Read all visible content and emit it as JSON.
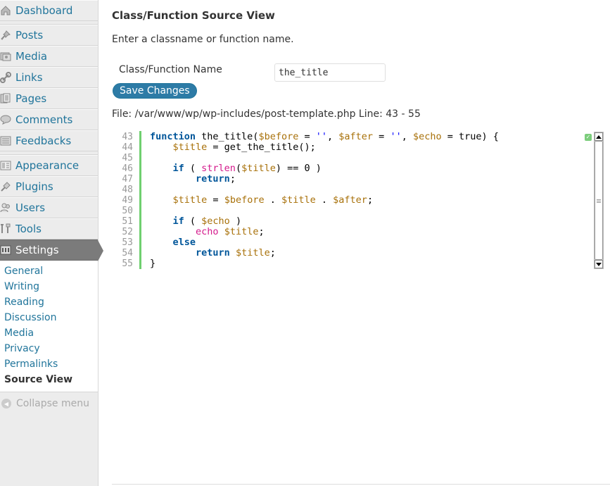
{
  "sidebar": {
    "menu": [
      {
        "key": "dashboard",
        "label": "Dashboard",
        "icon": "dashboard-icon"
      },
      {
        "key": "posts",
        "label": "Posts",
        "icon": "pushpin-icon"
      },
      {
        "key": "media",
        "label": "Media",
        "icon": "media-icon"
      },
      {
        "key": "links",
        "label": "Links",
        "icon": "link-icon"
      },
      {
        "key": "pages",
        "label": "Pages",
        "icon": "pages-icon"
      },
      {
        "key": "comments",
        "label": "Comments",
        "icon": "comment-bubble-icon"
      },
      {
        "key": "feedbacks",
        "label": "Feedbacks",
        "icon": "feedback-icon"
      },
      {
        "key": "appearance",
        "label": "Appearance",
        "icon": "appearance-icon"
      },
      {
        "key": "plugins",
        "label": "Plugins",
        "icon": "plug-icon"
      },
      {
        "key": "users",
        "label": "Users",
        "icon": "users-icon"
      },
      {
        "key": "tools",
        "label": "Tools",
        "icon": "tools-icon"
      },
      {
        "key": "settings",
        "label": "Settings",
        "icon": "settings-icon"
      }
    ],
    "submenu": [
      "General",
      "Writing",
      "Reading",
      "Discussion",
      "Media",
      "Privacy",
      "Permalinks",
      "Source View"
    ],
    "current_submenu": "Source View",
    "collapse_label": "Collapse menu"
  },
  "main": {
    "title": "Class/Function Source View",
    "intro": "Enter a classname or function name.",
    "field_label": "Class/Function Name",
    "field_value": "the_title",
    "save_label": "Save Changes",
    "file_info": "File: /var/www/wp/wp-includes/post-template.php Line: 43 - 55"
  },
  "code": {
    "line_numbers": [
      "43",
      "44",
      "45",
      "46",
      "47",
      "48",
      "49",
      "50",
      "51",
      "52",
      "53",
      "54",
      "55"
    ],
    "lines": [
      "function the_title($before = '', $after = '', $echo = true) {",
      "    $title = get_the_title();",
      "",
      "    if ( strlen($title) == 0 )",
      "        return;",
      "",
      "    $title = $before . $title . $after;",
      "",
      "    if ( $echo )",
      "        echo $title;",
      "    else",
      "        return $title;",
      "}"
    ]
  },
  "colors": {
    "link": "#21759b",
    "keyword": "#00569a",
    "variable": "#a8710a",
    "builtin": "#d41a8c",
    "string": "#0000ff",
    "gutter_bar": "#6fcf6f"
  }
}
